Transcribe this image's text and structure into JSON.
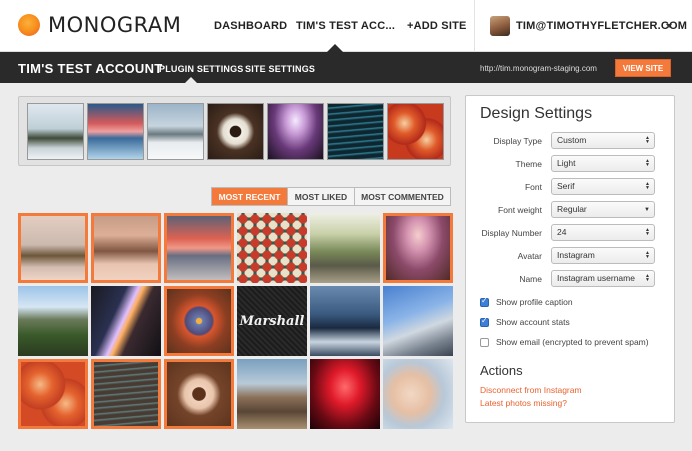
{
  "header": {
    "logo_text": "MONOGRAM",
    "nav": [
      "DASHBOARD",
      "TIM'S TEST ACC...",
      "+ADD SITE"
    ],
    "user_email": "TIM@TIMOTHYFLETCHER.COM"
  },
  "subbar": {
    "account_title": "TIM'S TEST ACCOUNT",
    "tabs": [
      "PLUGIN SETTINGS",
      "SITE SETTINGS"
    ],
    "site_url": "http://tim.monogram-staging.com",
    "view_site_label": "VIEW SITE"
  },
  "featured_photos": [
    "winter-trees",
    "snowy-sunset",
    "snowy-park",
    "coffee-cup",
    "train-tracks",
    "code-screen",
    "orange-pattern"
  ],
  "filter_tabs": {
    "items": [
      "MOST RECENT",
      "MOST LIKED",
      "MOST COMMENTED"
    ],
    "active": "MOST RECENT"
  },
  "grid_photos": [
    [
      "winter-trees",
      "snowy-sunset",
      "snowy-trees-sunset",
      "colorful-keys",
      "bicycle-path",
      "train-tracks"
    ],
    [
      "mountain-valley",
      "light-flare",
      "blue-circle-art",
      "marshall-amp",
      "tables-blue",
      "metal-structure"
    ],
    [
      "orange-pattern",
      "code-screen",
      "coffee-cup",
      "thatched-huts",
      "red-neon",
      "baby-face"
    ]
  ],
  "design_settings": {
    "title": "Design Settings",
    "fields": [
      {
        "label": "Display Type",
        "value": "Custom"
      },
      {
        "label": "Theme",
        "value": "Light"
      },
      {
        "label": "Font",
        "value": "Serif"
      },
      {
        "label": "Font weight",
        "value": "Regular"
      },
      {
        "label": "Display Number",
        "value": "24"
      },
      {
        "label": "Avatar",
        "value": "Instagram"
      },
      {
        "label": "Name",
        "value": "Instagram username"
      }
    ],
    "checkboxes": [
      {
        "label": "Show profile caption",
        "checked": true
      },
      {
        "label": "Show account stats",
        "checked": true
      },
      {
        "label": "Show email (encrypted to prevent spam)",
        "checked": false
      }
    ]
  },
  "actions": {
    "title": "Actions",
    "links": [
      "Disconnect from Instagram",
      "Latest photos missing?"
    ]
  },
  "colors": {
    "accent": "#f47a3b",
    "dark_bar": "#2a2a2a",
    "checkbox": "#3b7fd6"
  }
}
